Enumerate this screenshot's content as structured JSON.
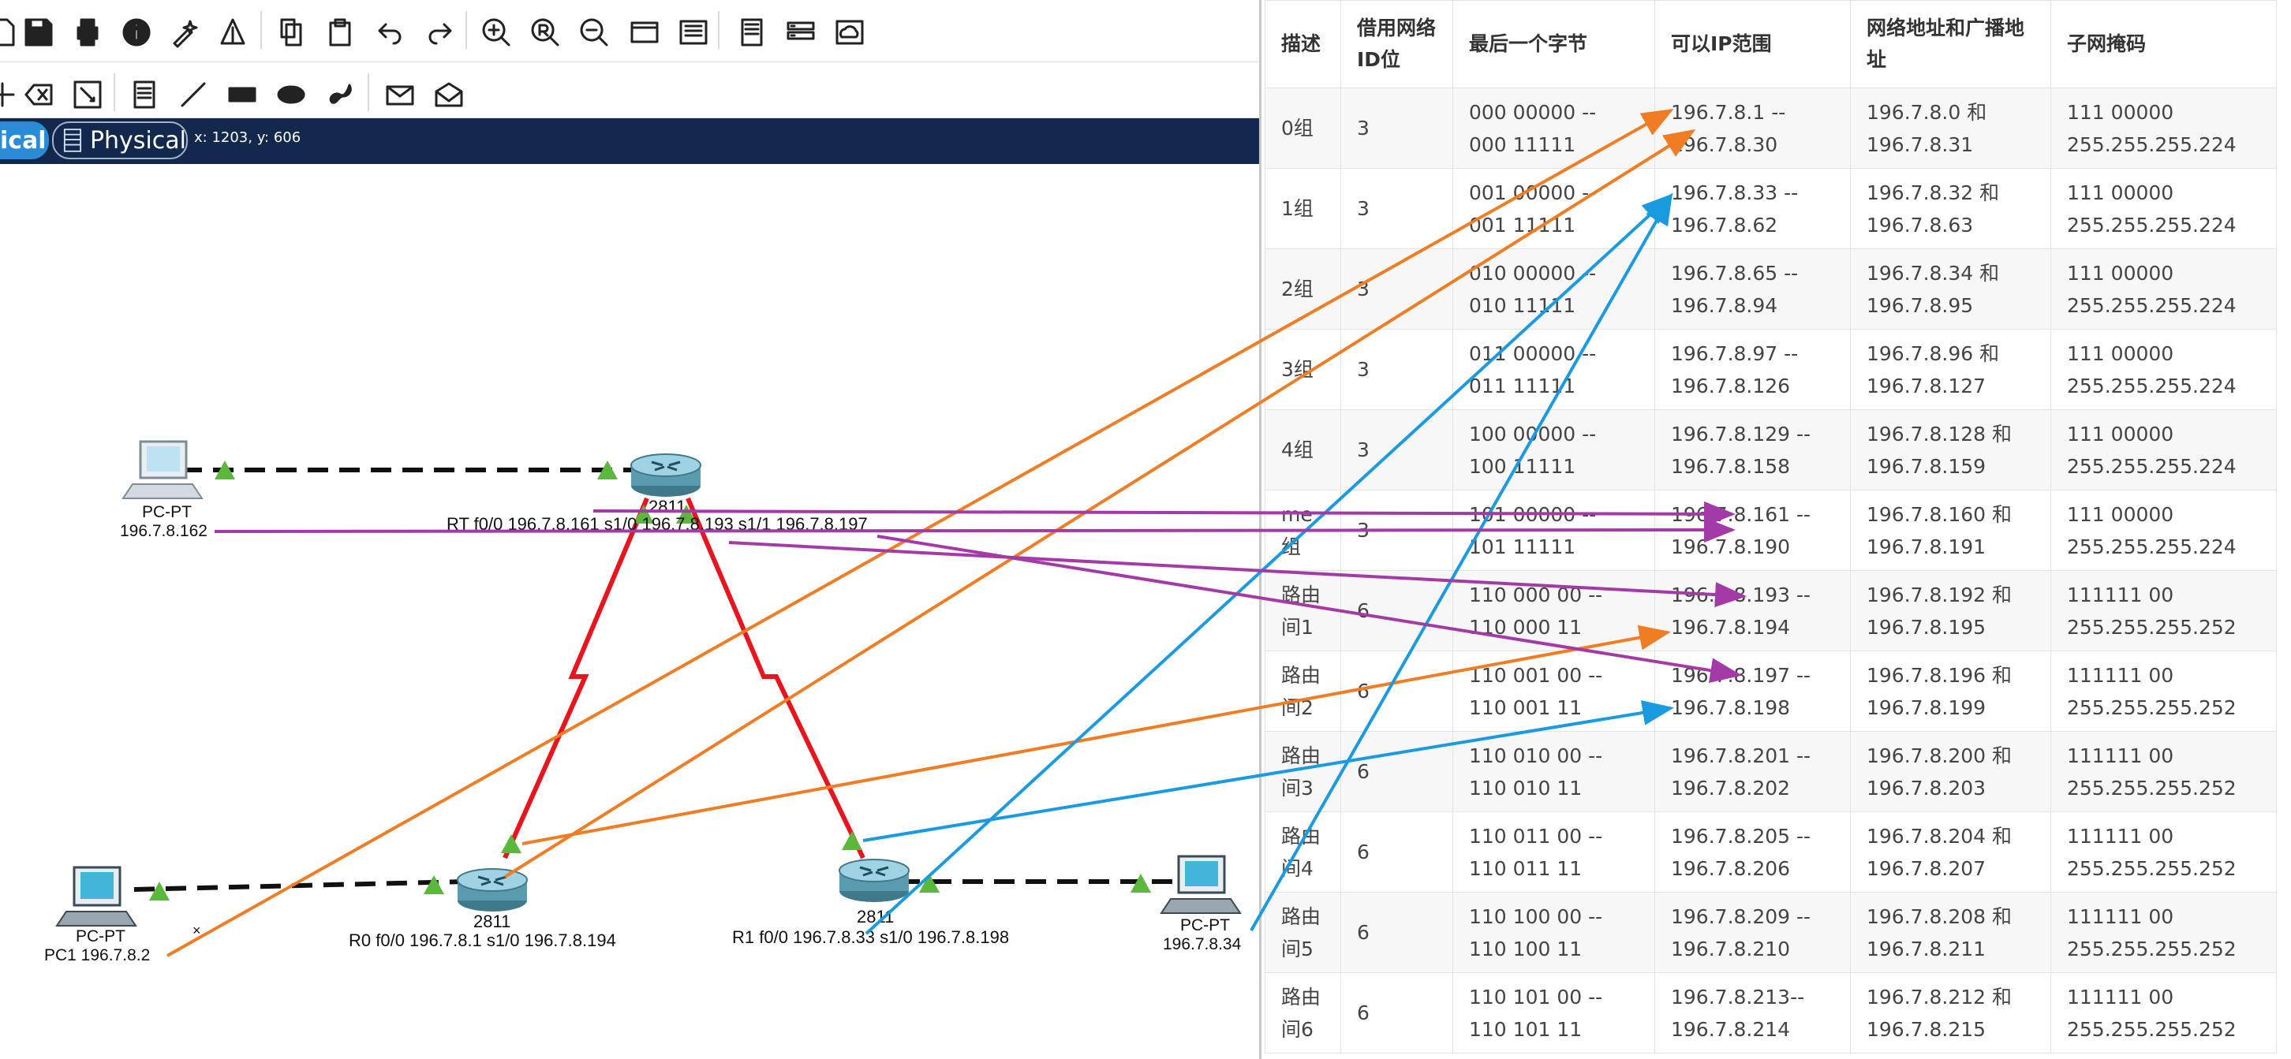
{
  "toolbar": {
    "row1_icons": [
      "new-icon",
      "save-icon",
      "print-icon",
      "info-icon",
      "wizard-icon",
      "network-icon",
      "copy-icon",
      "paste-icon",
      "undo-icon",
      "redo-icon",
      "zoom-in-icon",
      "zoom-reset-icon",
      "zoom-out-icon",
      "rectangle-view-icon",
      "viewport-icon",
      "notes-icon",
      "device-template-icon",
      "cluster-icon"
    ],
    "row2_icons": [
      "select-icon",
      "delete-icon",
      "resize-icon",
      "note-icon",
      "line-icon",
      "rectangle-icon",
      "ellipse-icon",
      "freeform-icon",
      "simple-pdu-icon",
      "complex-pdu-icon"
    ]
  },
  "view_bar": {
    "logical_label": "ical",
    "physical_label": "Physical",
    "coords": "x: 1203, y: 606"
  },
  "topology": {
    "routers": [
      {
        "model": "2811",
        "label": "RT  f0/0 196.7.8.161  s1/0 196.7.8.193  s1/1 196.7.8.197"
      },
      {
        "model": "2811",
        "label": "R0  f0/0 196.7.8.1   s1/0   196.7.8.194"
      },
      {
        "model": "2811",
        "label": "R1 f0/0 196.7.8.33   s1/0 196.7.8.198"
      }
    ],
    "pcs": [
      {
        "type": "PC-PT",
        "label": "196.7.8.162"
      },
      {
        "type": "PC-PT",
        "label": "PC1 196.7.8.2"
      },
      {
        "type": "PC-PT",
        "label": "196.7.8.34"
      }
    ],
    "colors": {
      "serial_link": "#e8141e",
      "ethernet_link": "#111111",
      "port_up": "#5cb83c",
      "orange_arrow": "#f07d23",
      "blue_arrow": "#1a9be0",
      "purple_arrow": "#a43aa8"
    }
  },
  "table": {
    "headers": [
      "描述",
      "借用网络ID位",
      "最后一个字节",
      "可以IP范围",
      "网络地址和广播地址",
      "子网掩码"
    ],
    "rows": [
      {
        "desc": "0组",
        "bits": "3",
        "last_byte": "000 00000   --\n000 11111",
        "ip_range": "196.7.8.1 --\n196.7.8.30",
        "net_bcast": "196.7.8.0 和\n196.7.8.31",
        "mask": "111  00000\n255.255.255.224"
      },
      {
        "desc": "1组",
        "bits": "3",
        "last_byte": "001 00000   --\n001 11111",
        "ip_range": "196.7.8.33 --\n196.7.8.62",
        "net_bcast": "196.7.8.32 和\n196.7.8.63",
        "mask": "111  00000\n255.255.255.224"
      },
      {
        "desc": "2组",
        "bits": "3",
        "last_byte": "010 00000   --\n010 11111",
        "ip_range": "196.7.8.65 --\n196.7.8.94",
        "net_bcast": "196.7.8.34 和\n196.7.8.95",
        "mask": "111  00000\n255.255.255.224"
      },
      {
        "desc": "3组",
        "bits": "3",
        "last_byte": "011 00000   --\n011 11111",
        "ip_range": "196.7.8.97 --\n196.7.8.126",
        "net_bcast": "196.7.8.96 和\n196.7.8.127",
        "mask": "111  00000\n255.255.255.224"
      },
      {
        "desc": "4组",
        "bits": "3",
        "last_byte": "100 00000   --\n100 11111",
        "ip_range": "196.7.8.129 --\n196.7.8.158",
        "net_bcast": "196.7.8.128 和\n196.7.8.159",
        "mask": "111  00000\n255.255.255.224"
      },
      {
        "desc": "me\n组",
        "bits": "3",
        "last_byte": "101 00000   --\n101 11111",
        "ip_range": "196.7.8.161 --\n196.7.8.190",
        "net_bcast": "196.7.8.160 和\n196.7.8.191",
        "mask": "111  00000\n255.255.255.224"
      },
      {
        "desc": "路由\n间1",
        "bits": "6",
        "last_byte": "110 000 00   --\n110 000 11",
        "ip_range": "196.7.8.193 --\n196.7.8.194",
        "net_bcast": "196.7.8.192 和\n196.7.8.195",
        "mask": "111111 00\n255.255.255.252"
      },
      {
        "desc": "路由\n间2",
        "bits": "6",
        "last_byte": "110 001 00   --\n110 001 11",
        "ip_range": "196.7.8.197 --\n196.7.8.198",
        "net_bcast": "196.7.8.196 和\n196.7.8.199",
        "mask": "111111 00\n255.255.255.252"
      },
      {
        "desc": "路由\n间3",
        "bits": "6",
        "last_byte": "110 010 00   --\n110 010 11",
        "ip_range": "196.7.8.201 --\n196.7.8.202",
        "net_bcast": "196.7.8.200 和\n196.7.8.203",
        "mask": "111111 00\n255.255.255.252"
      },
      {
        "desc": "路由\n间4",
        "bits": "6",
        "last_byte": "110 011 00   --\n110 011 11",
        "ip_range": "196.7.8.205 --\n196.7.8.206",
        "net_bcast": "196.7.8.204 和\n196.7.8.207",
        "mask": "111111 00\n255.255.255.252"
      },
      {
        "desc": "路由\n间5",
        "bits": "6",
        "last_byte": "110 100 00   --\n110 100 11",
        "ip_range": "196.7.8.209 --\n196.7.8.210",
        "net_bcast": "196.7.8.208 和\n196.7.8.211",
        "mask": "111111 00\n255.255.255.252"
      },
      {
        "desc": "路由\n间6",
        "bits": "6",
        "last_byte": "110 101 00   --\n110 101 11",
        "ip_range": "196.7.8.213--\n196.7.8.214",
        "net_bcast": "196.7.8.212 和\n196.7.8.215",
        "mask": "111111 00\n255.255.255.252"
      }
    ]
  }
}
